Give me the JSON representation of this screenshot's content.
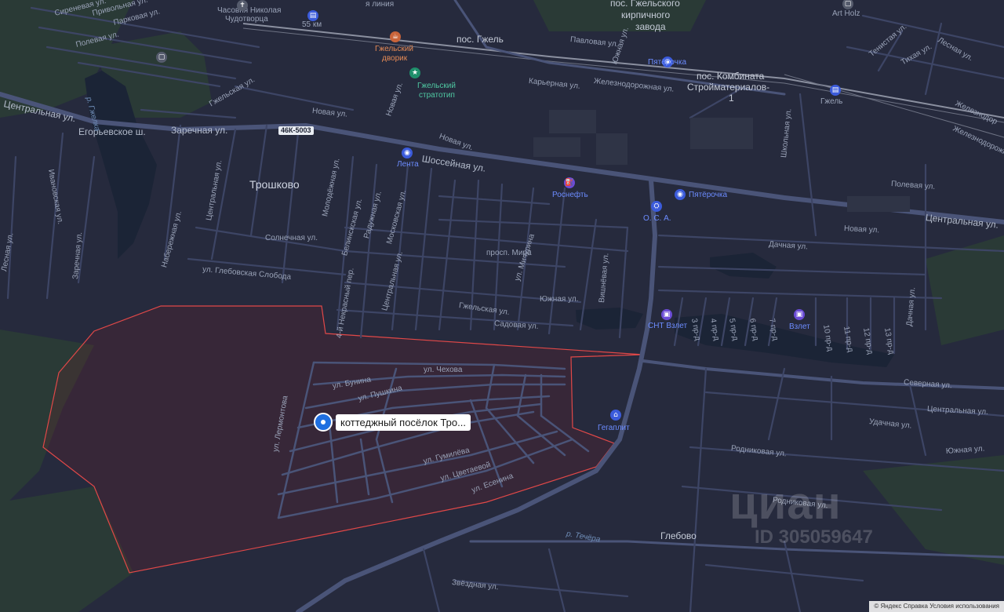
{
  "places": {
    "troshkovo": "Трошково",
    "gzhel": "пос. Гжель",
    "kirpich_1": "пос. Гжельского",
    "kirpich_2": "кирпичного",
    "kirpich_3": "завода",
    "kombinat_1": "пос. Комбината",
    "kombinat_2": "Стройматериалов-",
    "kombinat_3": "1",
    "glebovo": "Глебово",
    "chasovnya_1": "Часовня Николая",
    "chasovnya_2": "Чудотворца",
    "km55": "55 км",
    "gzhel_station": "Гжель",
    "art_holz": "Art Holz"
  },
  "roads": {
    "shosseynaya": "Шоссейная ул.",
    "egoryevskoe": "Егорьевское ш.",
    "zarechnaya": "Заречная ул.",
    "tsentralnaya_w": "Центральная ул.",
    "tsentralnaya_e": "Центральная ул.",
    "novaya_1": "Новая ул.",
    "novaya_2": "Новая ул.",
    "novaya_3": "Новая ул.",
    "novaya_4": "Новая ул.",
    "solnechnaya": "Солнечная ул.",
    "glebovskaya": "ул. Глебовская Слобода",
    "sirenevaya": "Сиреневая ул.",
    "privolnaya": "Привольная ул.",
    "parkovaya": "Парковая ул.",
    "polevaya_w": "Полевая ул.",
    "polevaya_e": "Полевая ул.",
    "karernaya": "Карьерная ул.",
    "zheleznodorozhnaya": "Железнодорожная ул.",
    "zheleznodor_e": "Железнодорожная",
    "pavlovaya": "Павловая ул.",
    "yuzhnaya_n": "Южная ул.",
    "gzhelskaya_n": "Гжельская ул.",
    "gzhelskaya": "Гжельская ул.",
    "prosp_mira": "просп. Мира",
    "yuzhnaya": "Южная ул.",
    "sadovaya": "Садовая ул.",
    "michurina": "ул. Мичурина",
    "vishnevaya": "Вишнёвая ул.",
    "tsentralnaya_mid": "Центральная ул.",
    "belinskogo": "Белинскская ул.",
    "radujnaya": "Радужная ул.",
    "moskovskaya": "Московская ул.",
    "molodezhnaya": "Молодёжная ул.",
    "nekrasova": "4-й Некрасный пер.",
    "tsentralnaya_v": "Центральная ул.",
    "naberezhnaya": "Набережная ул.",
    "ivanovskaya": "Ивановская ул.",
    "lesnaya_w": "Лесная ул.",
    "zarechnaya_v": "Заречная ул.",
    "gzhelka_r": "р. Гжелка",
    "chekhova": "ул. Чехова",
    "bunina": "ул. Бунина",
    "pushkina": "ул. Пушкина",
    "lermontova": "ул. Лермонтова",
    "gumileva": "ул. Гумилёва",
    "tsvetaevoy": "ул. Цветаевой",
    "esenina": "ул. Есенина",
    "dachnaya": "Дачная ул.",
    "dachnaya_v": "Дачная ул.",
    "shkolnaya": "Школьная ул.",
    "severnaya": "Северная ул.",
    "tsentralnaya_se": "Центральная ул.",
    "udachnaya": "Удачная ул.",
    "yuzhnaya_e": "Южная ул.",
    "rodnikovaya_1": "Родниковая ул.",
    "rodnikovaya_2": "Родниковая ул.",
    "zvezdnaya": "Звёздная ул.",
    "techera": "р. Течёра",
    "lesnaya_ne": "Лесная ул.",
    "tenistaya": "Тенистая ул.",
    "tikhaya": "Тихая ул.",
    "zhelezn_ne": "Железнодор",
    "liniya": "я линия",
    "pr3": "3 пр-д",
    "pr4": "4 пр-д",
    "pr5": "5 пр-д",
    "pr6": "6 пр-д",
    "pr7": "7 пр-д",
    "pr10": "10 пр-д",
    "pr11": "11 пр-д",
    "pr12": "12 пр-д",
    "pr13": "13 пр-д"
  },
  "shield": "46К-5003",
  "pois": {
    "gzhelsky_dvorik_1": "Гжельский",
    "gzhelsky_dvorik_2": "дворик",
    "stratotip_1": "Гжельский",
    "stratotip_2": "стратотип",
    "lenta": "Лента",
    "rosneft": "Роснефть",
    "pyaterochka_1": "Пятёрочка",
    "pyaterochka_2": "Пятёрочка",
    "osa": "О. С. А.",
    "snt_vzlet": "СНТ Взлет",
    "vzlet": "Взлет",
    "gegaplit": "Гегаплит"
  },
  "marker": {
    "label": "коттеджный посёлок Тро..."
  },
  "watermark": {
    "logo": "циан",
    "id": "ID 305059647"
  },
  "footer": "© Яндекс  Справка  Условия использования"
}
